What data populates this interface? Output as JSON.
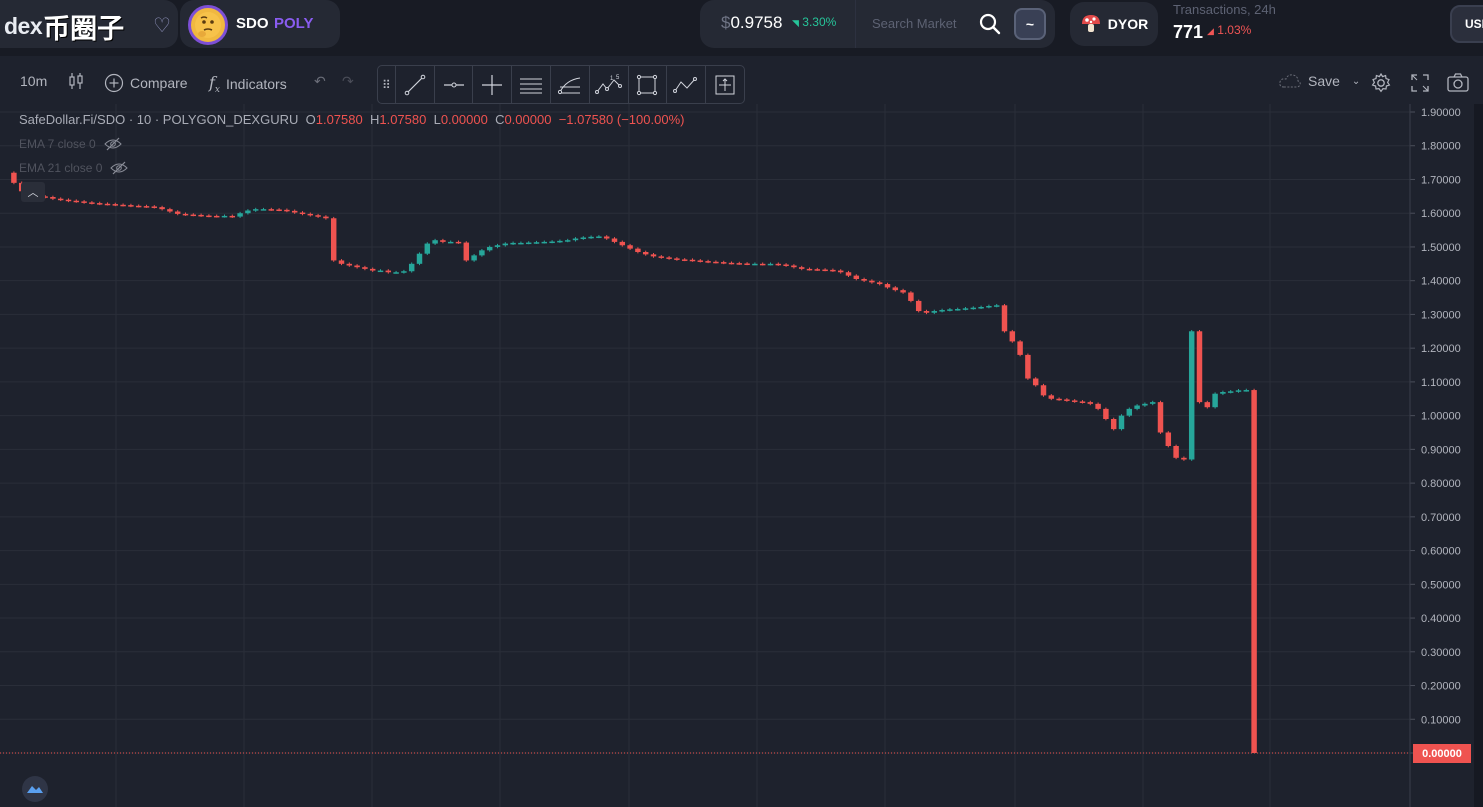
{
  "header": {
    "brand": {
      "logo_text": "dex",
      "logo_cn": "币圈子"
    },
    "token": {
      "symbol": "SDO",
      "chain": "POLY",
      "avatar": "thinking-face"
    },
    "price": {
      "currency": "$",
      "value": "0.9758",
      "change": "3.30%",
      "change_direction": "up"
    },
    "search": {
      "placeholder": "Search Market",
      "value": ""
    },
    "mode_button": "~",
    "dyor": {
      "label": "DYOR",
      "icon": "mushroom-icon"
    },
    "transactions": {
      "label": "Transactions, 24h",
      "count": "771",
      "change": "1.03%",
      "change_direction": "down"
    },
    "currency_button": "USD"
  },
  "toolbar": {
    "interval": "10m",
    "compare": "Compare",
    "indicators": "Indicators",
    "save": "Save",
    "drawing_tools": [
      "trend-line-icon",
      "horizontal-ray-icon",
      "crosshair-icon",
      "parallel-channel-icon",
      "fib-retracement-icon",
      "elliott-wave-icon",
      "rectangle-icon",
      "path-icon",
      "measure-icon"
    ]
  },
  "legend": {
    "symbol": "SafeDollar.Fi/SDO",
    "interval": "10",
    "exchange": "POLYGON_DEXGURU",
    "o_label": "O",
    "o": "1.07580",
    "h_label": "H",
    "h": "1.07580",
    "l_label": "L",
    "l": "0.00000",
    "c_label": "C",
    "c": "0.00000",
    "change": "−1.07580 (−100.00%)",
    "ema7": "EMA 7 close 0",
    "ema21": "EMA 21 close 0"
  },
  "colors": {
    "up": "#26a69a",
    "down": "#ef5350",
    "background": "#1e222d",
    "grid": "#2a2e39"
  },
  "chart_data": {
    "type": "candlestick",
    "ylim": [
      0.0,
      1.9
    ],
    "y_ticks": [
      "1.90000",
      "1.80000",
      "1.70000",
      "1.60000",
      "1.50000",
      "1.40000",
      "1.30000",
      "1.20000",
      "1.10000",
      "1.00000",
      "0.90000",
      "0.80000",
      "0.70000",
      "0.60000",
      "0.50000",
      "0.40000",
      "0.30000",
      "0.20000",
      "0.10000",
      "0.00000"
    ],
    "y_tick_values": [
      1.9,
      1.8,
      1.7,
      1.6,
      1.5,
      1.4,
      1.3,
      1.2,
      1.1,
      1.0,
      0.9,
      0.8,
      0.7,
      0.6,
      0.5,
      0.4,
      0.3,
      0.2,
      0.1,
      0.0
    ],
    "last_price_label": "0.00000",
    "last_price": 0.0,
    "segments": [
      {
        "dir": "down",
        "steps": [
          1.72,
          1.69,
          1.665,
          1.655,
          1.65
        ]
      },
      {
        "dir": "down",
        "steps": [
          1.65,
          1.648,
          1.643,
          1.64,
          1.637,
          1.635,
          1.632,
          1.63,
          1.628,
          1.627,
          1.625,
          1.624,
          1.622,
          1.621,
          1.62,
          1.618
        ]
      },
      {
        "dir": "down",
        "steps": [
          1.618,
          1.612,
          1.605,
          1.598,
          1.596,
          1.595,
          1.593,
          1.592,
          1.591,
          1.592,
          1.59
        ]
      },
      {
        "dir": "up",
        "steps": [
          1.59,
          1.6,
          1.608,
          1.612,
          1.612,
          1.611,
          1.61
        ]
      },
      {
        "dir": "down",
        "steps": [
          1.61,
          1.607,
          1.602,
          1.598,
          1.594,
          1.59,
          1.585
        ]
      },
      {
        "dir": "down",
        "steps": [
          1.585,
          1.46,
          1.45,
          1.445,
          1.44,
          1.435,
          1.43,
          1.43,
          1.425,
          1.425,
          1.428
        ]
      },
      {
        "dir": "up",
        "steps": [
          1.428,
          1.45,
          1.48,
          1.51,
          1.52,
          1.515,
          1.515,
          1.513
        ]
      },
      {
        "dir": "down",
        "steps": [
          1.513,
          1.46
        ]
      },
      {
        "dir": "up",
        "steps": [
          1.46,
          1.475,
          1.49,
          1.5,
          1.505,
          1.51,
          1.512,
          1.512,
          1.513,
          1.514,
          1.515,
          1.516,
          1.518,
          1.52,
          1.525,
          1.528,
          1.53,
          1.531
        ]
      },
      {
        "dir": "down",
        "steps": [
          1.531,
          1.525,
          1.515,
          1.505,
          1.495,
          1.485,
          1.478,
          1.472,
          1.469,
          1.466,
          1.463,
          1.462,
          1.46,
          1.458,
          1.456,
          1.455,
          1.453,
          1.452,
          1.451,
          1.45,
          1.45,
          1.449,
          1.45,
          1.448,
          1.445,
          1.44,
          1.435,
          1.434,
          1.433,
          1.432,
          1.43,
          1.425,
          1.415,
          1.405,
          1.4,
          1.395,
          1.39,
          1.38,
          1.372,
          1.365,
          1.34,
          1.31,
          1.305
        ]
      },
      {
        "dir": "up",
        "steps": [
          1.305,
          1.31,
          1.313,
          1.315,
          1.316,
          1.318,
          1.32,
          1.322,
          1.325,
          1.327
        ]
      },
      {
        "dir": "down",
        "steps": [
          1.327,
          1.25,
          1.22,
          1.18,
          1.11,
          1.09,
          1.06,
          1.05,
          1.048,
          1.045,
          1.042,
          1.04,
          1.035,
          1.02,
          0.99,
          0.96
        ]
      },
      {
        "dir": "up",
        "steps": [
          0.96,
          1.0,
          1.02,
          1.03,
          1.035,
          1.04
        ]
      },
      {
        "dir": "down",
        "steps": [
          1.04,
          0.95,
          0.91,
          0.875,
          0.87
        ]
      },
      {
        "dir": "up",
        "steps": [
          0.87,
          1.25
        ]
      },
      {
        "dir": "down",
        "steps": [
          1.25,
          1.04,
          1.025
        ]
      },
      {
        "dir": "up",
        "steps": [
          1.025,
          1.065,
          1.07,
          1.072,
          1.075,
          1.0758
        ]
      },
      {
        "dir": "down",
        "steps": [
          1.0758,
          0.0
        ]
      }
    ]
  }
}
